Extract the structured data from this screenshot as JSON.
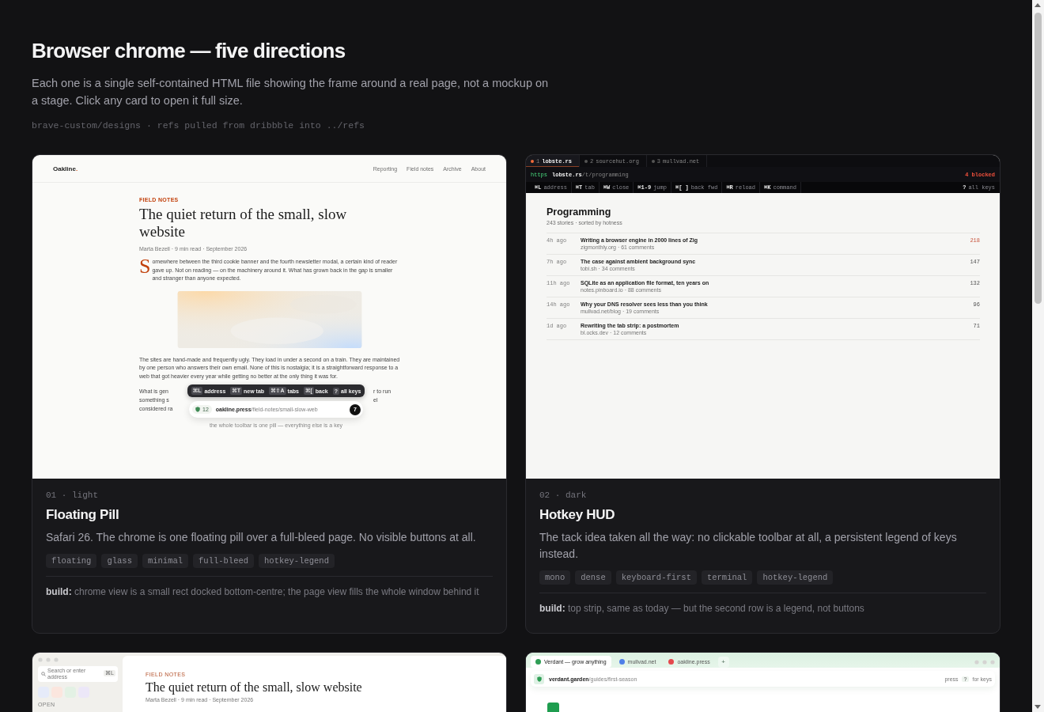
{
  "header": {
    "title": "Browser chrome — five directions",
    "description": "Each one is a single self-contained HTML file showing the frame around a real page, not a mockup on a stage. Click any card to open it full size.",
    "path": "brave-custom/designs · refs pulled from dribbble into ../refs"
  },
  "cards": [
    {
      "kind": "pill",
      "label": "01 · light",
      "title": "Floating Pill",
      "description": "Safari 26. The chrome is one floating pill over a full-bleed page. No visible buttons at all.",
      "tags": [
        "floating",
        "glass",
        "minimal",
        "full-bleed",
        "hotkey-legend"
      ],
      "build": "**build:** chrome view is a small rect docked bottom-centre; the page view fills the whole window behind it",
      "preview": {
        "brand": "Oakline",
        "brand_mark": ".",
        "nav": [
          "Reporting",
          "Field notes",
          "Archive",
          "About"
        ],
        "kicker": "FIELD NOTES",
        "headline": "The quiet return of the small, slow website",
        "byline": "Marta Bezell · 9 min read · September 2026",
        "drop_cap": "S",
        "lede": "omewhere between the third cookie banner and the fourth newsletter modal, a certain kind of reader gave up. Not on reading — on the machinery around it. What has grown back in the gap is smaller and stranger than anyone expected.",
        "image": {
          "kind": "picture"
        },
        "paragraph": "The sites are hand-made and frequently ugly. They load in under a second on a train. They are maintained by one person who answers their own email. None of this is nostalgia; it is a straightforward response to a web that got heavier every year while getting no better at the only thing it was for.",
        "covered_lines": [
          {
            "start": "What is gen",
            "end": "r to run"
          },
          {
            "start": "something s",
            "end": "el"
          },
          {
            "start": "considered ra"
          }
        ],
        "hotkeys": [
          {
            "key": "⌘L",
            "label": "address"
          },
          {
            "key": "⌘T",
            "label": "new tab"
          },
          {
            "key": "⌘⇧A",
            "label": "tabs"
          },
          {
            "key": "⌘[",
            "label": "back"
          },
          {
            "key": "?",
            "label": "all keys"
          }
        ],
        "pill": {
          "count": "12",
          "host": "oakline.press",
          "path": "/field-notes/small-slow-web",
          "badge": "7"
        },
        "caption": "the whole toolbar is one pill — everything else is a key"
      }
    },
    {
      "kind": "hud",
      "label": "02 · dark",
      "title": "Hotkey HUD",
      "description": "The tack idea taken all the way: no clickable toolbar at all, a persistent legend of keys instead.",
      "tags": [
        "mono",
        "dense",
        "keyboard-first",
        "terminal",
        "hotkey-legend"
      ],
      "build": "**build:** top strip, same as today — but the second row is a legend, not buttons",
      "preview": {
        "tabs": [
          {
            "number": "1",
            "label": "lobste.rs",
            "selected": true
          },
          {
            "number": "2",
            "label": "sourcehut.org",
            "selected": false
          },
          {
            "number": "3",
            "label": "mullvad.net",
            "selected": false
          }
        ],
        "url": {
          "scheme": "https",
          "host": "lobste.rs",
          "path": "/t/programming",
          "blocked": "4 blocked"
        },
        "legend": [
          {
            "key": "⌘L",
            "label": "address"
          },
          {
            "key": "⌘T",
            "label": "tab"
          },
          {
            "key": "⌘W",
            "label": "close"
          },
          {
            "key": "⌘1-9",
            "label": "jump"
          },
          {
            "key": "⌘[ ]",
            "label": "back fwd"
          },
          {
            "key": "⌘R",
            "label": "reload"
          },
          {
            "key": "⌘K",
            "label": "command"
          }
        ],
        "legend_end": {
          "key": "?",
          "label": "all keys"
        },
        "heading": "Programming",
        "subheading": "243 stories · sorted by hotness",
        "stories": [
          {
            "age": "4h ago",
            "title": "Writing a browser engine in 2000 lines of Zig",
            "meta": "zigmonthly.org · 61 comments",
            "score": "218",
            "hot": true
          },
          {
            "age": "7h ago",
            "title": "The case against ambient background sync",
            "meta": "tobi.sh · 34 comments",
            "score": "147",
            "hot": false
          },
          {
            "age": "11h ago",
            "title": "SQLite as an application file format, ten years on",
            "meta": "notes.pinboard.io · 88 comments",
            "score": "132",
            "hot": false
          },
          {
            "age": "14h ago",
            "title": "Why your DNS resolver sees less than you think",
            "meta": "mullvad.net/blog · 19 comments",
            "score": "96",
            "hot": false
          },
          {
            "age": "1d ago",
            "title": "Rewriting the tab strip: a postmortem",
            "meta": "bl.ocks.dev · 12 comments",
            "score": "71",
            "hot": false
          }
        ]
      }
    },
    {
      "kind": "sidebar",
      "preview": {
        "search": {
          "placeholder": "Search or enter address",
          "key": "⌘L"
        },
        "pinned": [
          {
            "color": "#e6ebf9"
          },
          {
            "color": "#fbe6de"
          },
          {
            "color": "#e3f1e4"
          },
          {
            "color": "#ece7f8"
          }
        ],
        "section": "OPEN",
        "kicker": "FIELD NOTES",
        "headline": "The quiet return of the small, slow website",
        "byline": "Marta Bezell · 9 min read · September 2026"
      }
    },
    {
      "kind": "tabs",
      "preview": {
        "tabs": [
          {
            "label": "Verdant — grow anything",
            "color": "#2f9e55",
            "selected": true
          },
          {
            "label": "mullvad.net",
            "color": "#4f7fe8",
            "selected": false
          },
          {
            "label": "oakline.press",
            "color": "#e5484d",
            "selected": false
          }
        ],
        "new_tab": "+",
        "address": {
          "host": "verdant.garden",
          "path": "/guides/first-season"
        },
        "hint": {
          "before": "press",
          "key": "?",
          "after": "for keys"
        }
      }
    }
  ]
}
